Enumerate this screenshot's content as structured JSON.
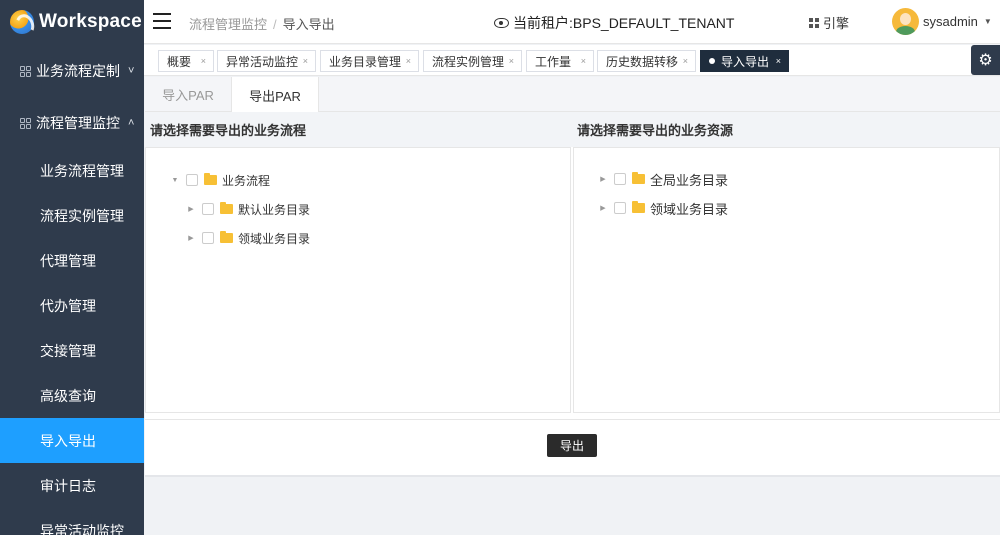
{
  "app": {
    "logo_text": "Workspace"
  },
  "sidebar": {
    "groups": [
      {
        "label": "业务流程定制",
        "chevron": "˅"
      },
      {
        "label": "流程管理监控",
        "chevron": "˄"
      }
    ],
    "items": [
      {
        "label": "业务流程管理"
      },
      {
        "label": "流程实例管理"
      },
      {
        "label": "代理管理"
      },
      {
        "label": "代办管理"
      },
      {
        "label": "交接管理"
      },
      {
        "label": "高级查询"
      },
      {
        "label": "导入导出"
      },
      {
        "label": "审计日志"
      },
      {
        "label": "异常活动监控"
      }
    ],
    "active_index": 6
  },
  "header": {
    "breadcrumb": [
      "流程管理监控",
      "导入导出"
    ],
    "tenant_label": "当前租户:BPS_DEFAULT_TENANT",
    "engine_label": "引擎",
    "username": "sysadmin"
  },
  "tabs": [
    {
      "label": "概要"
    },
    {
      "label": "异常活动监控"
    },
    {
      "label": "业务目录管理"
    },
    {
      "label": "流程实例管理"
    },
    {
      "label": "工作量"
    },
    {
      "label": "历史数据转移"
    },
    {
      "label": "导入导出"
    }
  ],
  "tab_close_glyph": "×",
  "subtabs": [
    {
      "label": "导入PAR"
    },
    {
      "label": "导出PAR"
    }
  ],
  "left_panel": {
    "title": "请选择需要导出的业务流程",
    "tree": [
      {
        "label": "业务流程",
        "expanded": true
      },
      {
        "label": "默认业务目录"
      },
      {
        "label": "领域业务目录"
      }
    ]
  },
  "right_panel": {
    "title": "请选择需要导出的业务资源",
    "tree": [
      {
        "label": "全局业务目录"
      },
      {
        "label": "领域业务目录"
      }
    ]
  },
  "actions": {
    "export_label": "导出"
  },
  "colors": {
    "sidebar_bg": "#2f3b4c",
    "active_menu": "#1e9fff",
    "active_tab": "#1f2d3d",
    "folder": "#f7c035"
  }
}
